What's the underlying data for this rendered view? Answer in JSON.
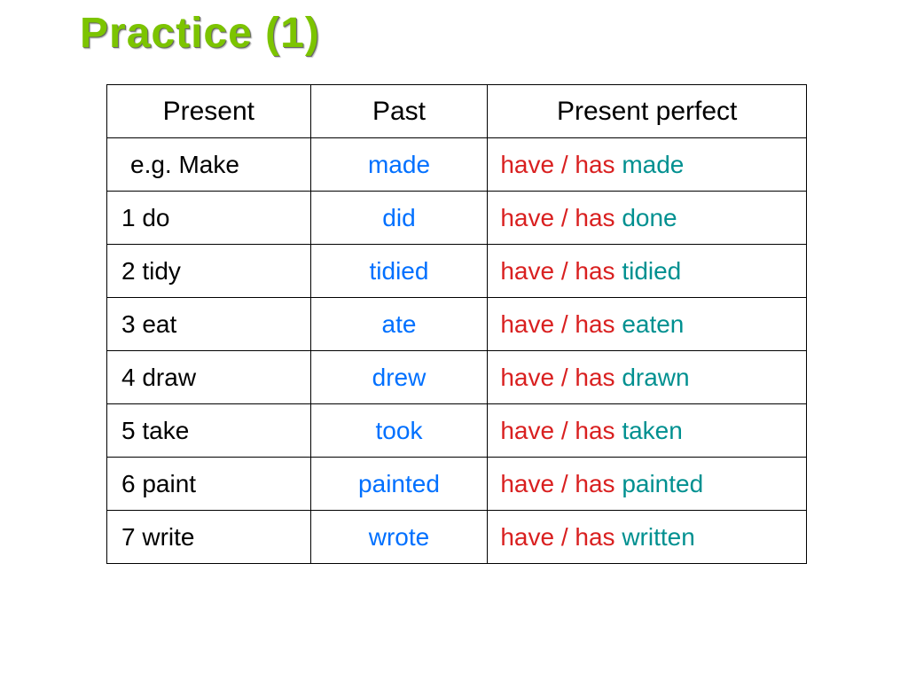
{
  "title": "Practice (1)",
  "headers": {
    "present": "Present",
    "past": "Past",
    "perfect": "Present perfect"
  },
  "perfect_prefix": "have / has",
  "rows": [
    {
      "present": "e.g. Make",
      "past": "made",
      "participle": "made"
    },
    {
      "present": "1  do",
      "past": "did",
      "participle": "done"
    },
    {
      "present": "2  tidy",
      "past": "tidied",
      "participle": "tidied"
    },
    {
      "present": "3  eat",
      "past": "ate",
      "participle": "eaten"
    },
    {
      "present": "4  draw",
      "past": "drew",
      "participle": "drawn"
    },
    {
      "present": "5  take",
      "past": "took",
      "participle": "taken"
    },
    {
      "present": "6  paint",
      "past": "painted",
      "participle": "painted"
    },
    {
      "present": "7  write",
      "past": "wrote",
      "participle": "written"
    }
  ]
}
